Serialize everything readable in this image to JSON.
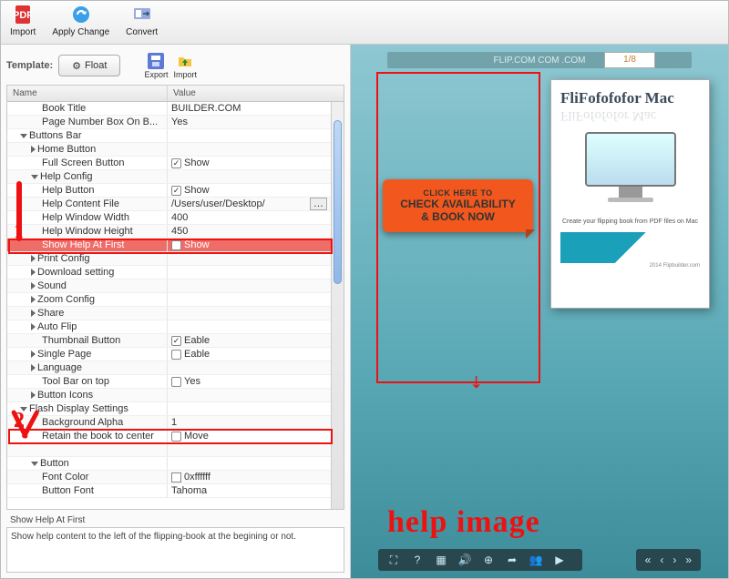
{
  "toolbar": {
    "import": "Import",
    "apply": "Apply Change",
    "convert": "Convert"
  },
  "template": {
    "label": "Template:",
    "button": "Float",
    "export": "Export",
    "import": "Import"
  },
  "grid": {
    "h_name": "Name",
    "h_value": "Value"
  },
  "rows": [
    {
      "n": "Book Title",
      "v": "BUILDER.COM",
      "ind": 3
    },
    {
      "n": "Page Number Box On B...",
      "v": "Yes",
      "ind": 3
    },
    {
      "n": "Buttons Bar",
      "v": "",
      "ind": 1,
      "exp": "d"
    },
    {
      "n": "Home Button",
      "v": "",
      "ind": 2,
      "exp": "r"
    },
    {
      "n": "Full Screen Button",
      "v": "Show",
      "ind": 3,
      "chk": true
    },
    {
      "n": "Help Config",
      "v": "",
      "ind": 2,
      "exp": "d"
    },
    {
      "n": "Help Button",
      "v": "Show",
      "ind": 3,
      "chk": true
    },
    {
      "n": "Help Content File",
      "v": "/Users/user/Desktop/",
      "ind": 3,
      "ext": true
    },
    {
      "n": "Help Window Width",
      "v": "400",
      "ind": 3
    },
    {
      "n": "Help Window Height",
      "v": "450",
      "ind": 3
    },
    {
      "n": "Show Help At First",
      "v": "Show",
      "ind": 3,
      "chk": true,
      "sel": true
    },
    {
      "n": "Print Config",
      "v": "",
      "ind": 2,
      "exp": "r"
    },
    {
      "n": "Download setting",
      "v": "",
      "ind": 2,
      "exp": "r"
    },
    {
      "n": "Sound",
      "v": "",
      "ind": 2,
      "exp": "r"
    },
    {
      "n": "Zoom Config",
      "v": "",
      "ind": 2,
      "exp": "r"
    },
    {
      "n": "Share",
      "v": "",
      "ind": 2,
      "exp": "r"
    },
    {
      "n": "Auto Flip",
      "v": "",
      "ind": 2,
      "exp": "r"
    },
    {
      "n": "Thumbnail Button",
      "v": "Eable",
      "ind": 3,
      "chk": true
    },
    {
      "n": "Single Page",
      "v": "Eable",
      "ind": 2,
      "exp": "r",
      "chk": false
    },
    {
      "n": "Language",
      "v": "",
      "ind": 2,
      "exp": "r"
    },
    {
      "n": "Tool Bar on top",
      "v": "Yes",
      "ind": 3,
      "chk": false
    },
    {
      "n": "Button Icons",
      "v": "",
      "ind": 2,
      "exp": "r"
    },
    {
      "n": "Flash Display Settings",
      "v": "",
      "ind": 1,
      "exp": "d"
    },
    {
      "n": "Background Alpha",
      "v": "1",
      "ind": 3
    },
    {
      "n": "Retain the book to center",
      "v": "Move",
      "ind": 3,
      "chk": false
    },
    {
      "n": "",
      "v": "",
      "ind": 3
    },
    {
      "n": "Button",
      "v": "",
      "ind": 2,
      "exp": "d"
    },
    {
      "n": "Font Color",
      "v": "0xffffff",
      "ind": 3,
      "sw": true
    },
    {
      "n": "Button Font",
      "v": "Tahoma",
      "ind": 3
    }
  ],
  "status": {
    "name": "Show Help At First",
    "desc": "Show help content to the left of the flipping-book at the begining or not."
  },
  "preview": {
    "strip": "FLIP.COM COM .COM",
    "page_num": "1/8",
    "cta": {
      "l1": "CLICK HERE TO",
      "l2": "CHECK AVAILABILITY",
      "l3": "& BOOK NOW"
    },
    "page": {
      "title": "FliFofofofor Mac",
      "mirror": "FliFofofofor Mac",
      "caption": "Create your flipping book from PDF files on Mac",
      "foot": "2014 Flipbuilder.com"
    },
    "annotation": "help image"
  }
}
